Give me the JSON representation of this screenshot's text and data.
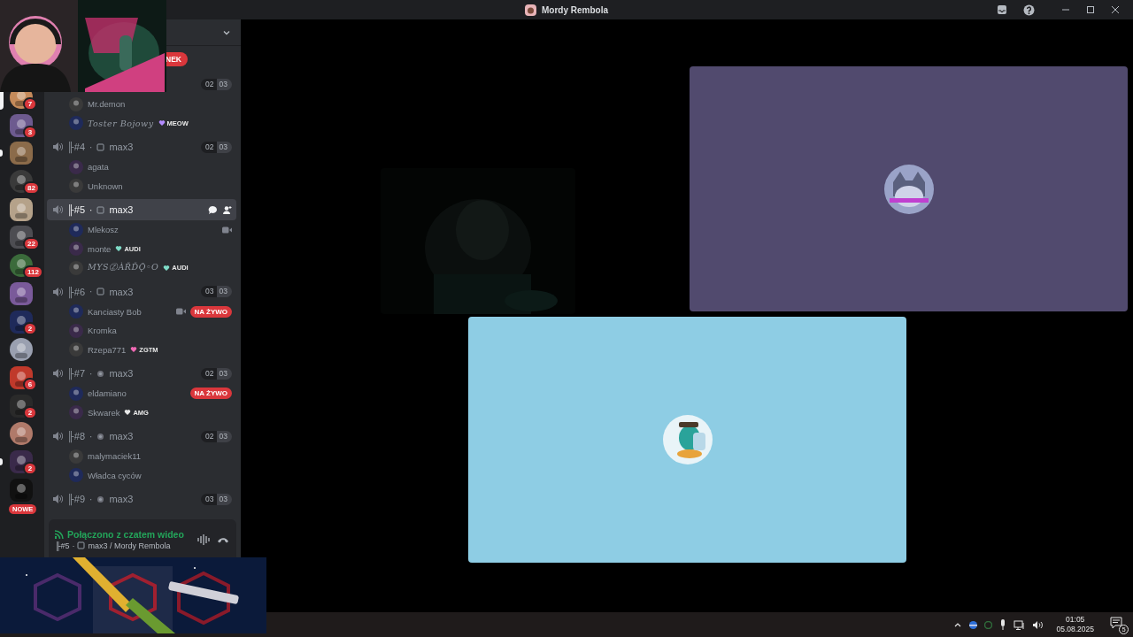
{
  "window": {
    "title": "Mordy Rembola"
  },
  "servers": [
    {
      "badge": "7",
      "selected": true,
      "unread": false
    },
    {
      "badge": "3",
      "selected": false,
      "unread": false
    },
    {
      "selected": false,
      "unread": true
    },
    {
      "badge": "82",
      "selected": false,
      "unread": false
    },
    {
      "selected": false,
      "unread": false
    },
    {
      "badge": "22",
      "selected": false,
      "unread": false
    },
    {
      "badge": "112",
      "selected": false,
      "unread": false
    },
    {
      "selected": false,
      "unread": false
    },
    {
      "badge": "2",
      "selected": false,
      "unread": false
    },
    {
      "selected": false,
      "unread": false
    },
    {
      "badge": "6",
      "selected": false,
      "unread": false
    },
    {
      "badge": "2",
      "selected": false,
      "unread": false
    },
    {
      "selected": false,
      "unread": false
    },
    {
      "badge": "2",
      "selected": false,
      "unread": true
    },
    {
      "new_badge": "NOWE",
      "selected": false,
      "unread": false
    }
  ],
  "event_badge": "NEK",
  "channels": [
    {
      "counts": [
        "02",
        "03"
      ],
      "users": [
        {
          "name": "Mr.demon"
        },
        {
          "name": "Toster Bojowy",
          "kind": "fancy",
          "tag": {
            "label": "MEOW",
            "color": "#b48cff"
          }
        }
      ]
    },
    {
      "prefix": "╟#4",
      "separator": "·",
      "kind": "window",
      "name": "max3",
      "counts": [
        "02",
        "03"
      ],
      "selected": false,
      "users": [
        {
          "name": "agata"
        },
        {
          "name": "Unknown"
        }
      ]
    },
    {
      "prefix": "╟#5",
      "separator": "·",
      "kind": "window",
      "name": "max3",
      "selected": true,
      "users": [
        {
          "name": "Mlekosz",
          "video": true
        },
        {
          "name": "monte",
          "tag": {
            "label": "AUDI",
            "color": "#7fdcc8"
          }
        },
        {
          "name": "MYSⓏÀŘĎǬ◦O",
          "kind": "fancy",
          "tag": {
            "label": "AUDI",
            "color": "#7fdcc8"
          }
        }
      ]
    },
    {
      "prefix": "╟#6",
      "separator": "·",
      "kind": "window",
      "name": "max3",
      "counts": [
        "03",
        "03"
      ],
      "selected": false,
      "users": [
        {
          "name": "Kanciasty Bob",
          "video": true,
          "live": "NA ŻYWO"
        },
        {
          "name": "Kromka"
        },
        {
          "name": "Rzepa771",
          "tag": {
            "label": "ZGTM",
            "color": "#f06ab4"
          }
        }
      ]
    },
    {
      "prefix": "╟#7",
      "separator": "·",
      "kind": "circle",
      "name": "max3",
      "counts": [
        "02",
        "03"
      ],
      "selected": false,
      "users": [
        {
          "name": "eldamiano",
          "live": "NA ŻYWO"
        },
        {
          "name": "Skwarek",
          "tag": {
            "label": "AMG",
            "color": "#e8e8e8"
          }
        }
      ]
    },
    {
      "prefix": "╟#8",
      "separator": "·",
      "kind": "circle",
      "name": "max3",
      "counts": [
        "02",
        "03"
      ],
      "selected": false,
      "users": [
        {
          "name": "malymaciek11"
        },
        {
          "name": "Władca cyców"
        }
      ]
    },
    {
      "prefix": "╟#9",
      "separator": "·",
      "kind": "circle",
      "name": "max3",
      "counts": [
        "03",
        "03"
      ],
      "selected": false
    }
  ],
  "voice_panel": {
    "status": "Połączono z czatem wideo",
    "prefix": "╟#5",
    "separator": "·",
    "kind": "window",
    "path": "max3 / Mordy Rembola"
  },
  "tiles": [
    {
      "kind": "camera"
    },
    {
      "kind": "avatar",
      "color": "#514a6e"
    },
    {
      "kind": "avatar",
      "color": "#8ecde4"
    }
  ],
  "taskbar": {
    "time": "01:05",
    "date": "05.08.2025",
    "notifications": "5"
  }
}
